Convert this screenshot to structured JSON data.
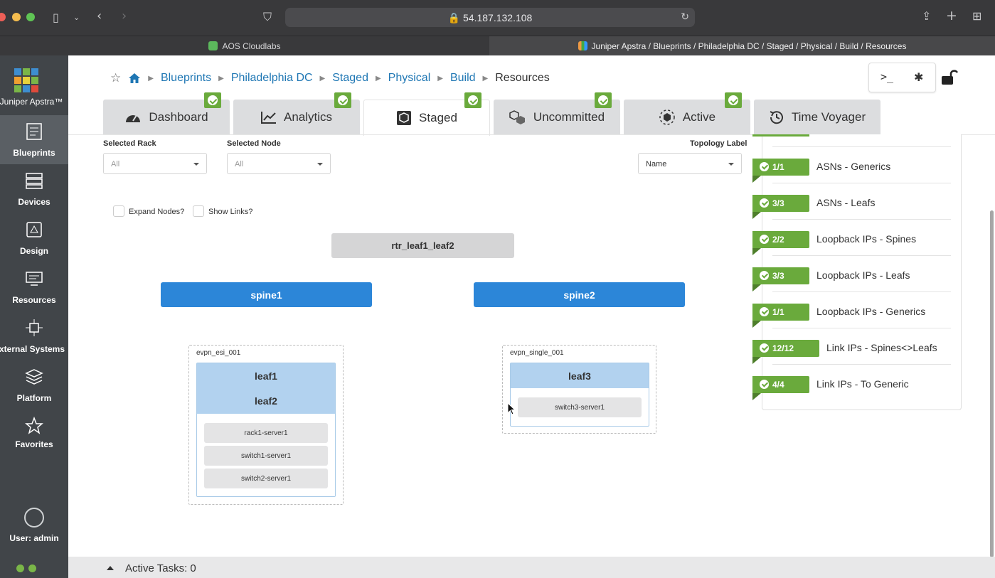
{
  "browser": {
    "url": "54.187.132.108",
    "tabs": [
      {
        "label": "AOS Cloudlabs",
        "active": false
      },
      {
        "label": "Juniper Apstra / Blueprints / Philadelphia DC / Staged / Physical / Build / Resources",
        "active": true
      }
    ]
  },
  "sidebar": {
    "logo_text": "Juniper Apstra™",
    "items": [
      {
        "label": "Blueprints",
        "icon": "blueprints-icon",
        "active": true
      },
      {
        "label": "Devices",
        "icon": "devices-icon",
        "active": false
      },
      {
        "label": "Design",
        "icon": "design-icon",
        "active": false
      },
      {
        "label": "Resources",
        "icon": "resources-icon",
        "active": false
      },
      {
        "label": "External Systems",
        "icon": "external-systems-icon",
        "active": false
      },
      {
        "label": "Platform",
        "icon": "platform-icon",
        "active": false
      },
      {
        "label": "Favorites",
        "icon": "star-icon",
        "active": false
      }
    ],
    "user_label": "User: admin",
    "status_color": "#7ab648"
  },
  "breadcrumb": [
    "Blueprints",
    "Philadelphia DC",
    "Staged",
    "Physical",
    "Build"
  ],
  "breadcrumb_current": "Resources",
  "tabs": [
    {
      "label": "Dashboard",
      "icon": "dashboard-icon",
      "checked": true
    },
    {
      "label": "Analytics",
      "icon": "analytics-icon",
      "checked": true
    },
    {
      "label": "Staged",
      "icon": "staged-icon",
      "checked": true,
      "active": true
    },
    {
      "label": "Uncommitted",
      "icon": "uncommitted-icon",
      "checked": true
    },
    {
      "label": "Active",
      "icon": "active-icon",
      "checked": true
    },
    {
      "label": "Time Voyager",
      "icon": "history-icon",
      "checked": false
    }
  ],
  "filters": {
    "rack_label": "Selected Rack",
    "rack_value": "All",
    "node_label": "Selected Node",
    "node_value": "All",
    "topology_label": "Topology Label",
    "topology_value": "Name"
  },
  "options": {
    "expand_nodes": "Expand Nodes?",
    "show_links": "Show Links?"
  },
  "topology": {
    "router": "rtr_leaf1_leaf2",
    "spines": [
      "spine1",
      "spine2"
    ],
    "racks": [
      {
        "name": "evpn_esi_001",
        "leafs": [
          "leaf1",
          "leaf2"
        ],
        "servers": [
          "rack1-server1",
          "switch1-server1",
          "switch2-server1"
        ]
      },
      {
        "name": "evpn_single_001",
        "leafs": [
          "leaf3"
        ],
        "servers": [
          "switch3-server1"
        ]
      }
    ]
  },
  "resources": [
    {
      "count": "1/1",
      "label": "ASNs - Generics"
    },
    {
      "count": "3/3",
      "label": "ASNs - Leafs"
    },
    {
      "count": "2/2",
      "label": "Loopback IPs - Spines"
    },
    {
      "count": "3/3",
      "label": "Loopback IPs - Leafs"
    },
    {
      "count": "1/1",
      "label": "Loopback IPs - Generics"
    },
    {
      "count": "12/12",
      "label": "Link IPs - Spines<>Leafs"
    },
    {
      "count": "4/4",
      "label": "Link IPs - To Generic"
    }
  ],
  "footer": {
    "active_tasks": "Active Tasks: 0"
  },
  "colors": {
    "accent": "#2c86d8",
    "success": "#6aaa3c",
    "sidebar": "#414549"
  }
}
